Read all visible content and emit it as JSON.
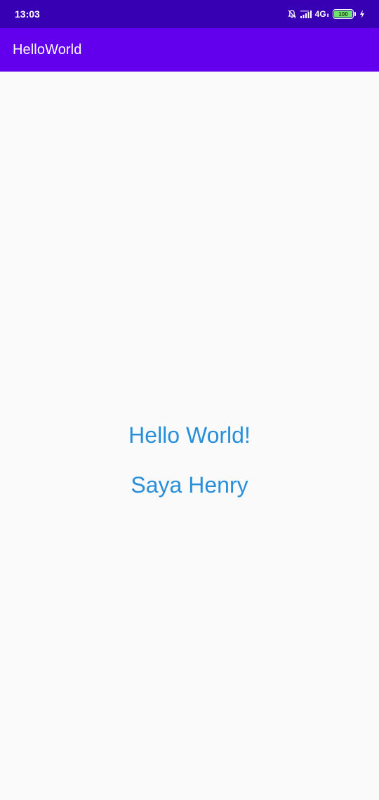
{
  "status_bar": {
    "time": "13:03",
    "network": "4G",
    "network_sub": "ll",
    "battery_level": "100",
    "icons": [
      "mute-bell-icon",
      "signal-icon",
      "charging-icon"
    ]
  },
  "app_bar": {
    "title": "HelloWorld",
    "color": "#6200ee",
    "status_color": "#3700b3"
  },
  "content": {
    "hello_text": "Hello World!",
    "name_text": "Saya Henry",
    "text_color": "#2a8fd9"
  }
}
